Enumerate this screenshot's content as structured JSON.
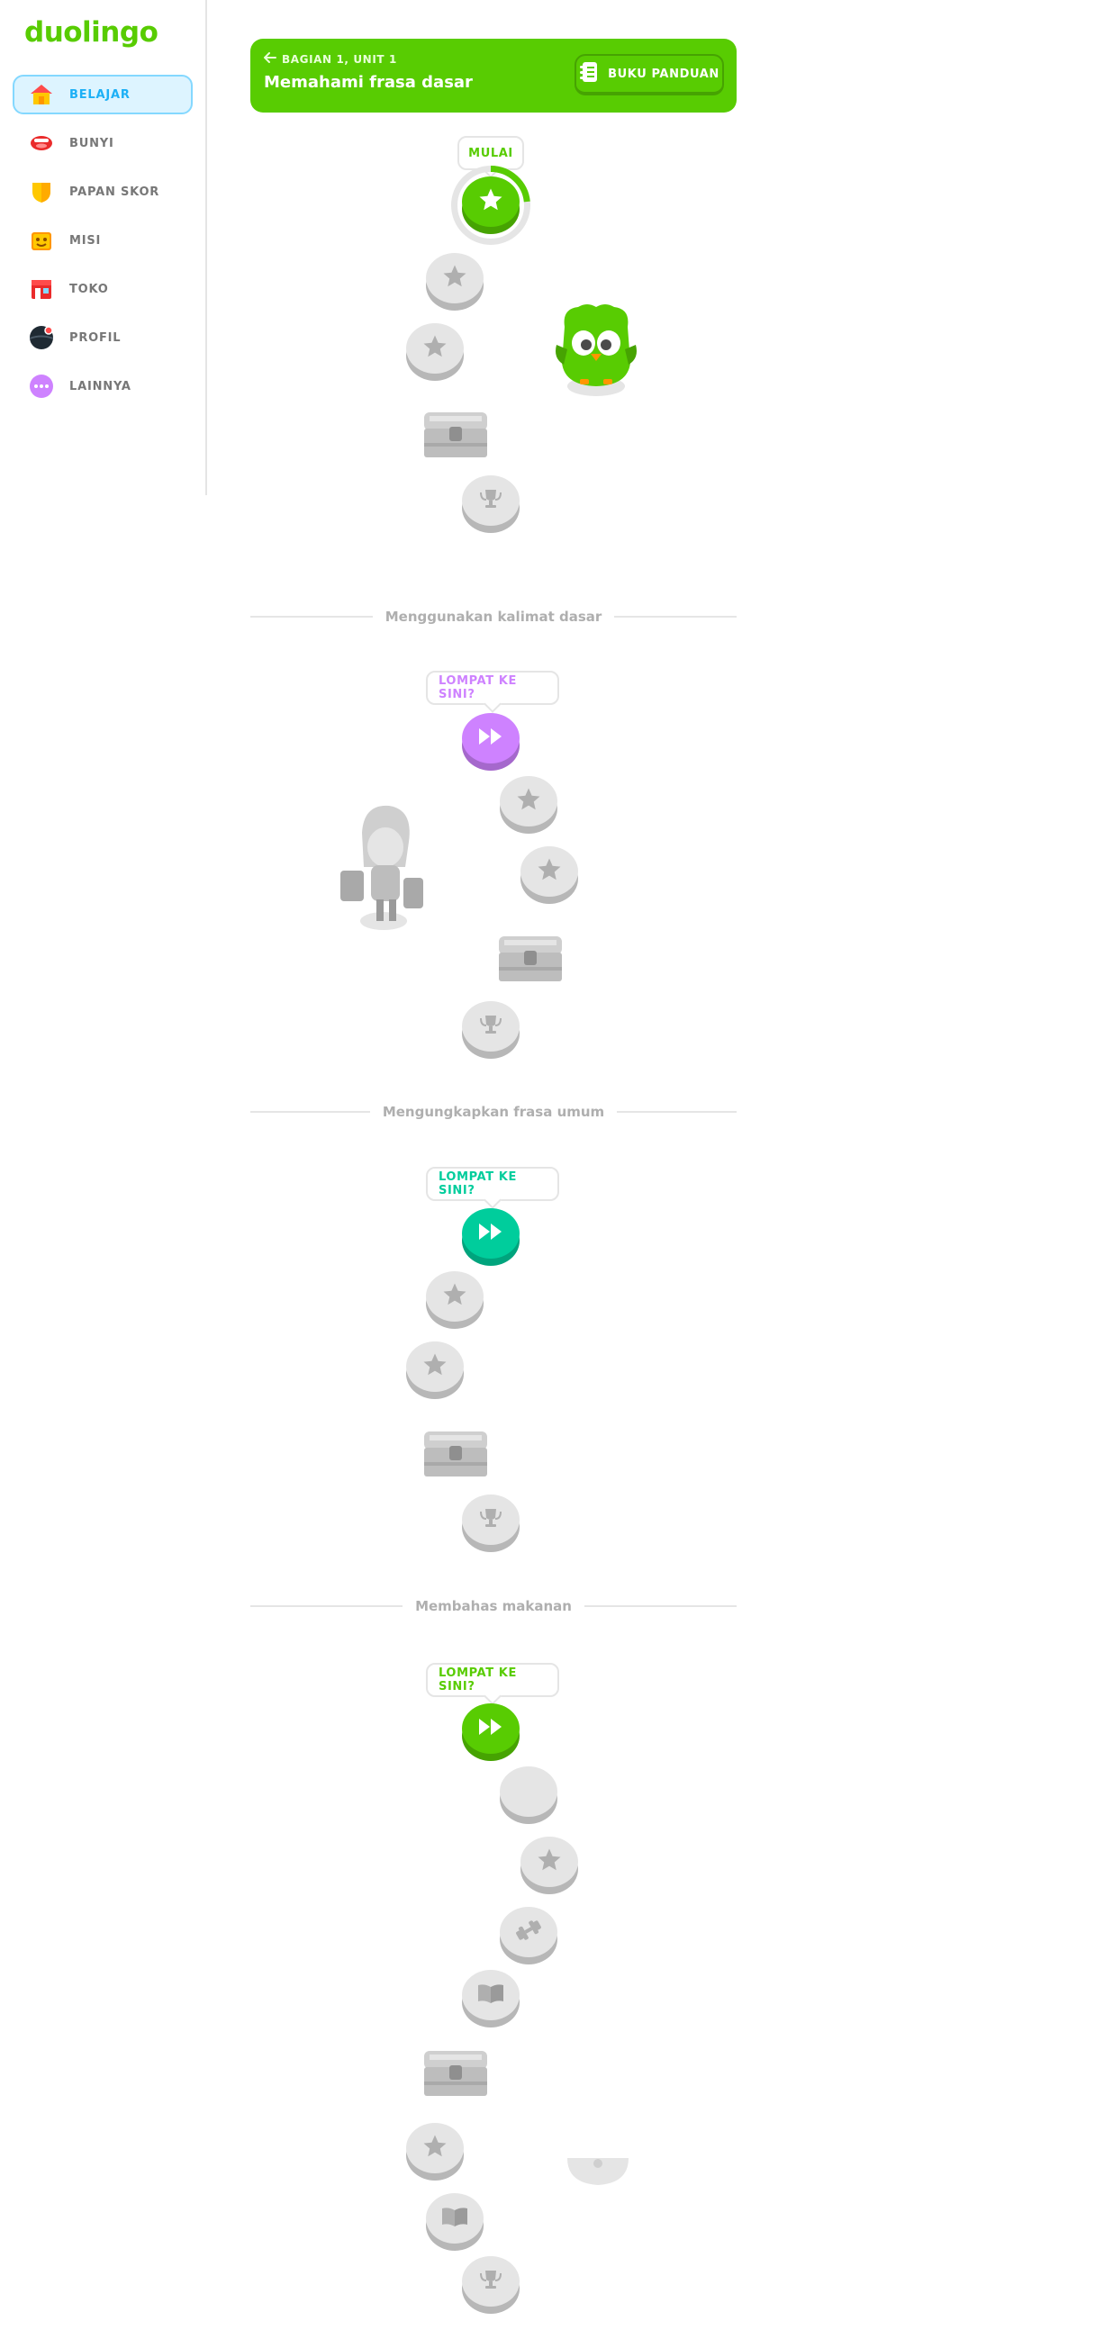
{
  "app": {
    "logo": "duolingo"
  },
  "sidebar": {
    "items": [
      {
        "label": "BELAJAR",
        "icon": "home-icon",
        "active": true
      },
      {
        "label": "BUNYI",
        "icon": "mouth-icon"
      },
      {
        "label": "PAPAN SKOR",
        "icon": "shield-icon"
      },
      {
        "label": "MISI",
        "icon": "quest-chest-icon"
      },
      {
        "label": "TOKO",
        "icon": "shop-icon"
      },
      {
        "label": "PROFIL",
        "icon": "avatar-icon"
      },
      {
        "label": "LAINNYA",
        "icon": "more-icon"
      }
    ]
  },
  "unit": {
    "subtitle": "BAGIAN 1, UNIT 1",
    "title": "Memahami frasa dasar",
    "guide_label": "BUKU PANDUAN"
  },
  "path": {
    "start_label": "MULAI",
    "jump_label": "LOMPAT KE SINI?"
  },
  "sections": [
    {
      "title": "Menggunakan kalimat dasar"
    },
    {
      "title": "Mengungkapkan frasa umum"
    },
    {
      "title": "Membahas makanan"
    }
  ],
  "colors": {
    "green": "#58cc02",
    "blue": "#1cb0f6",
    "purple": "#ce82ff",
    "teal": "#00cd9c",
    "locked": "#e5e5e5"
  }
}
